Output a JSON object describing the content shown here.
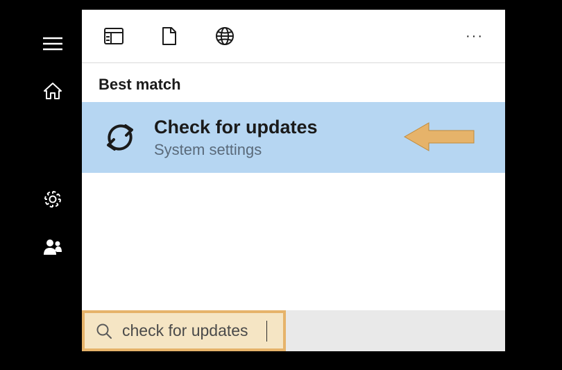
{
  "sidebar": {
    "items": [
      {
        "name": "hamburger-icon"
      },
      {
        "name": "home-icon"
      },
      {
        "name": "settings-icon"
      },
      {
        "name": "people-icon"
      }
    ]
  },
  "toolbar": {
    "items": [
      {
        "name": "apps-icon"
      },
      {
        "name": "document-icon"
      },
      {
        "name": "web-icon"
      }
    ],
    "more": "···"
  },
  "section": {
    "header": "Best match"
  },
  "result": {
    "title": "Check for updates",
    "subtitle": "System settings"
  },
  "search": {
    "value": "check for updates",
    "placeholder": ""
  },
  "colors": {
    "highlight": "#b6d6f2",
    "annotation": "#e6b36a"
  }
}
